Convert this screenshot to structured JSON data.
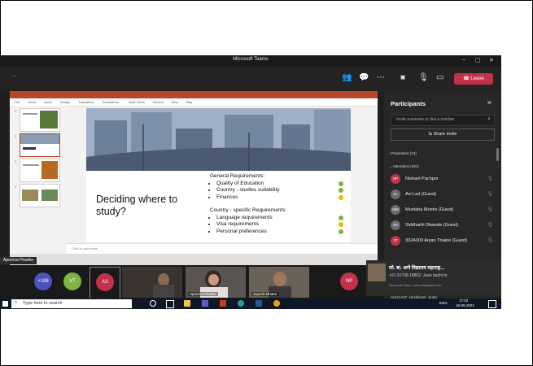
{
  "app": {
    "window_title": "Microsoft Teams",
    "leave_label": "Leave"
  },
  "powerpoint": {
    "menu": [
      "File",
      "Home",
      "Insert",
      "Design",
      "Transitions",
      "Animations",
      "Slide Show",
      "Review",
      "View",
      "Help"
    ],
    "notes_placeholder": "Click to add notes",
    "presenter_name": "Apoorva Phadke",
    "slide": {
      "headline": "Deciding where to study?",
      "section1_title": "General Requirements:",
      "section1_items": [
        "Quality of Education",
        "Country - studies suitability",
        "Finances"
      ],
      "section2_title": "Country - specific Requirements:",
      "section2_items": [
        "Language requirements",
        "Visa requirements",
        "Personal preferences"
      ],
      "indicator_colors": {
        "section1": [
          "#7cb342",
          "#7cb342",
          "#f4b400"
        ],
        "section2": [
          "#7cb342",
          "#f4b400",
          "#7cb342"
        ]
      }
    }
  },
  "participants_panel": {
    "title": "Participants",
    "invite_placeholder": "Invite someone or dial a number",
    "share_invite": "Share invite",
    "presenters_label": "Presenters (13)",
    "attendees_label": "Attendees (181)",
    "attendees": [
      {
        "initials": "NP",
        "name": "Nishant Pachpor",
        "color": "#c4314b"
      },
      {
        "initials": "AL",
        "name": "Avi Lad (Guest)",
        "color": "#6b6b6b"
      },
      {
        "initials": "MM",
        "name": "Muntaha Momin (Guest)",
        "color": "#6b6b6b"
      },
      {
        "initials": "SD",
        "name": "Siddharth Dhavale (Guest)",
        "color": "#6b6b6b"
      },
      {
        "initials": "3T",
        "name": "302A009 Aryan Thakre (Guest)",
        "color": "#c4314b"
      }
    ]
  },
  "video_strip": {
    "count_badge": "+188",
    "tiles": [
      {
        "initials": "VT",
        "color": "#7cb342"
      },
      {
        "initials": "AS",
        "color": "#c4314b"
      }
    ],
    "video_labels": [
      "Apoorva Phadke",
      "Jayesh Mhatre"
    ],
    "np_initials": "NP"
  },
  "notification": {
    "title": "लो. बा. अणे विद्यालय महाराष्ट्र...",
    "subtitle": "+91 91768 18802: Jaan bachi to",
    "source": "Microsoft Edge • web.whatsapp.com",
    "next_row": "AUG1A07_Hrishikesh_Sutar"
  },
  "taskbar": {
    "search_placeholder": "Type here to search",
    "language": "ENG",
    "time": "17:02",
    "date": "16-05-2021"
  }
}
